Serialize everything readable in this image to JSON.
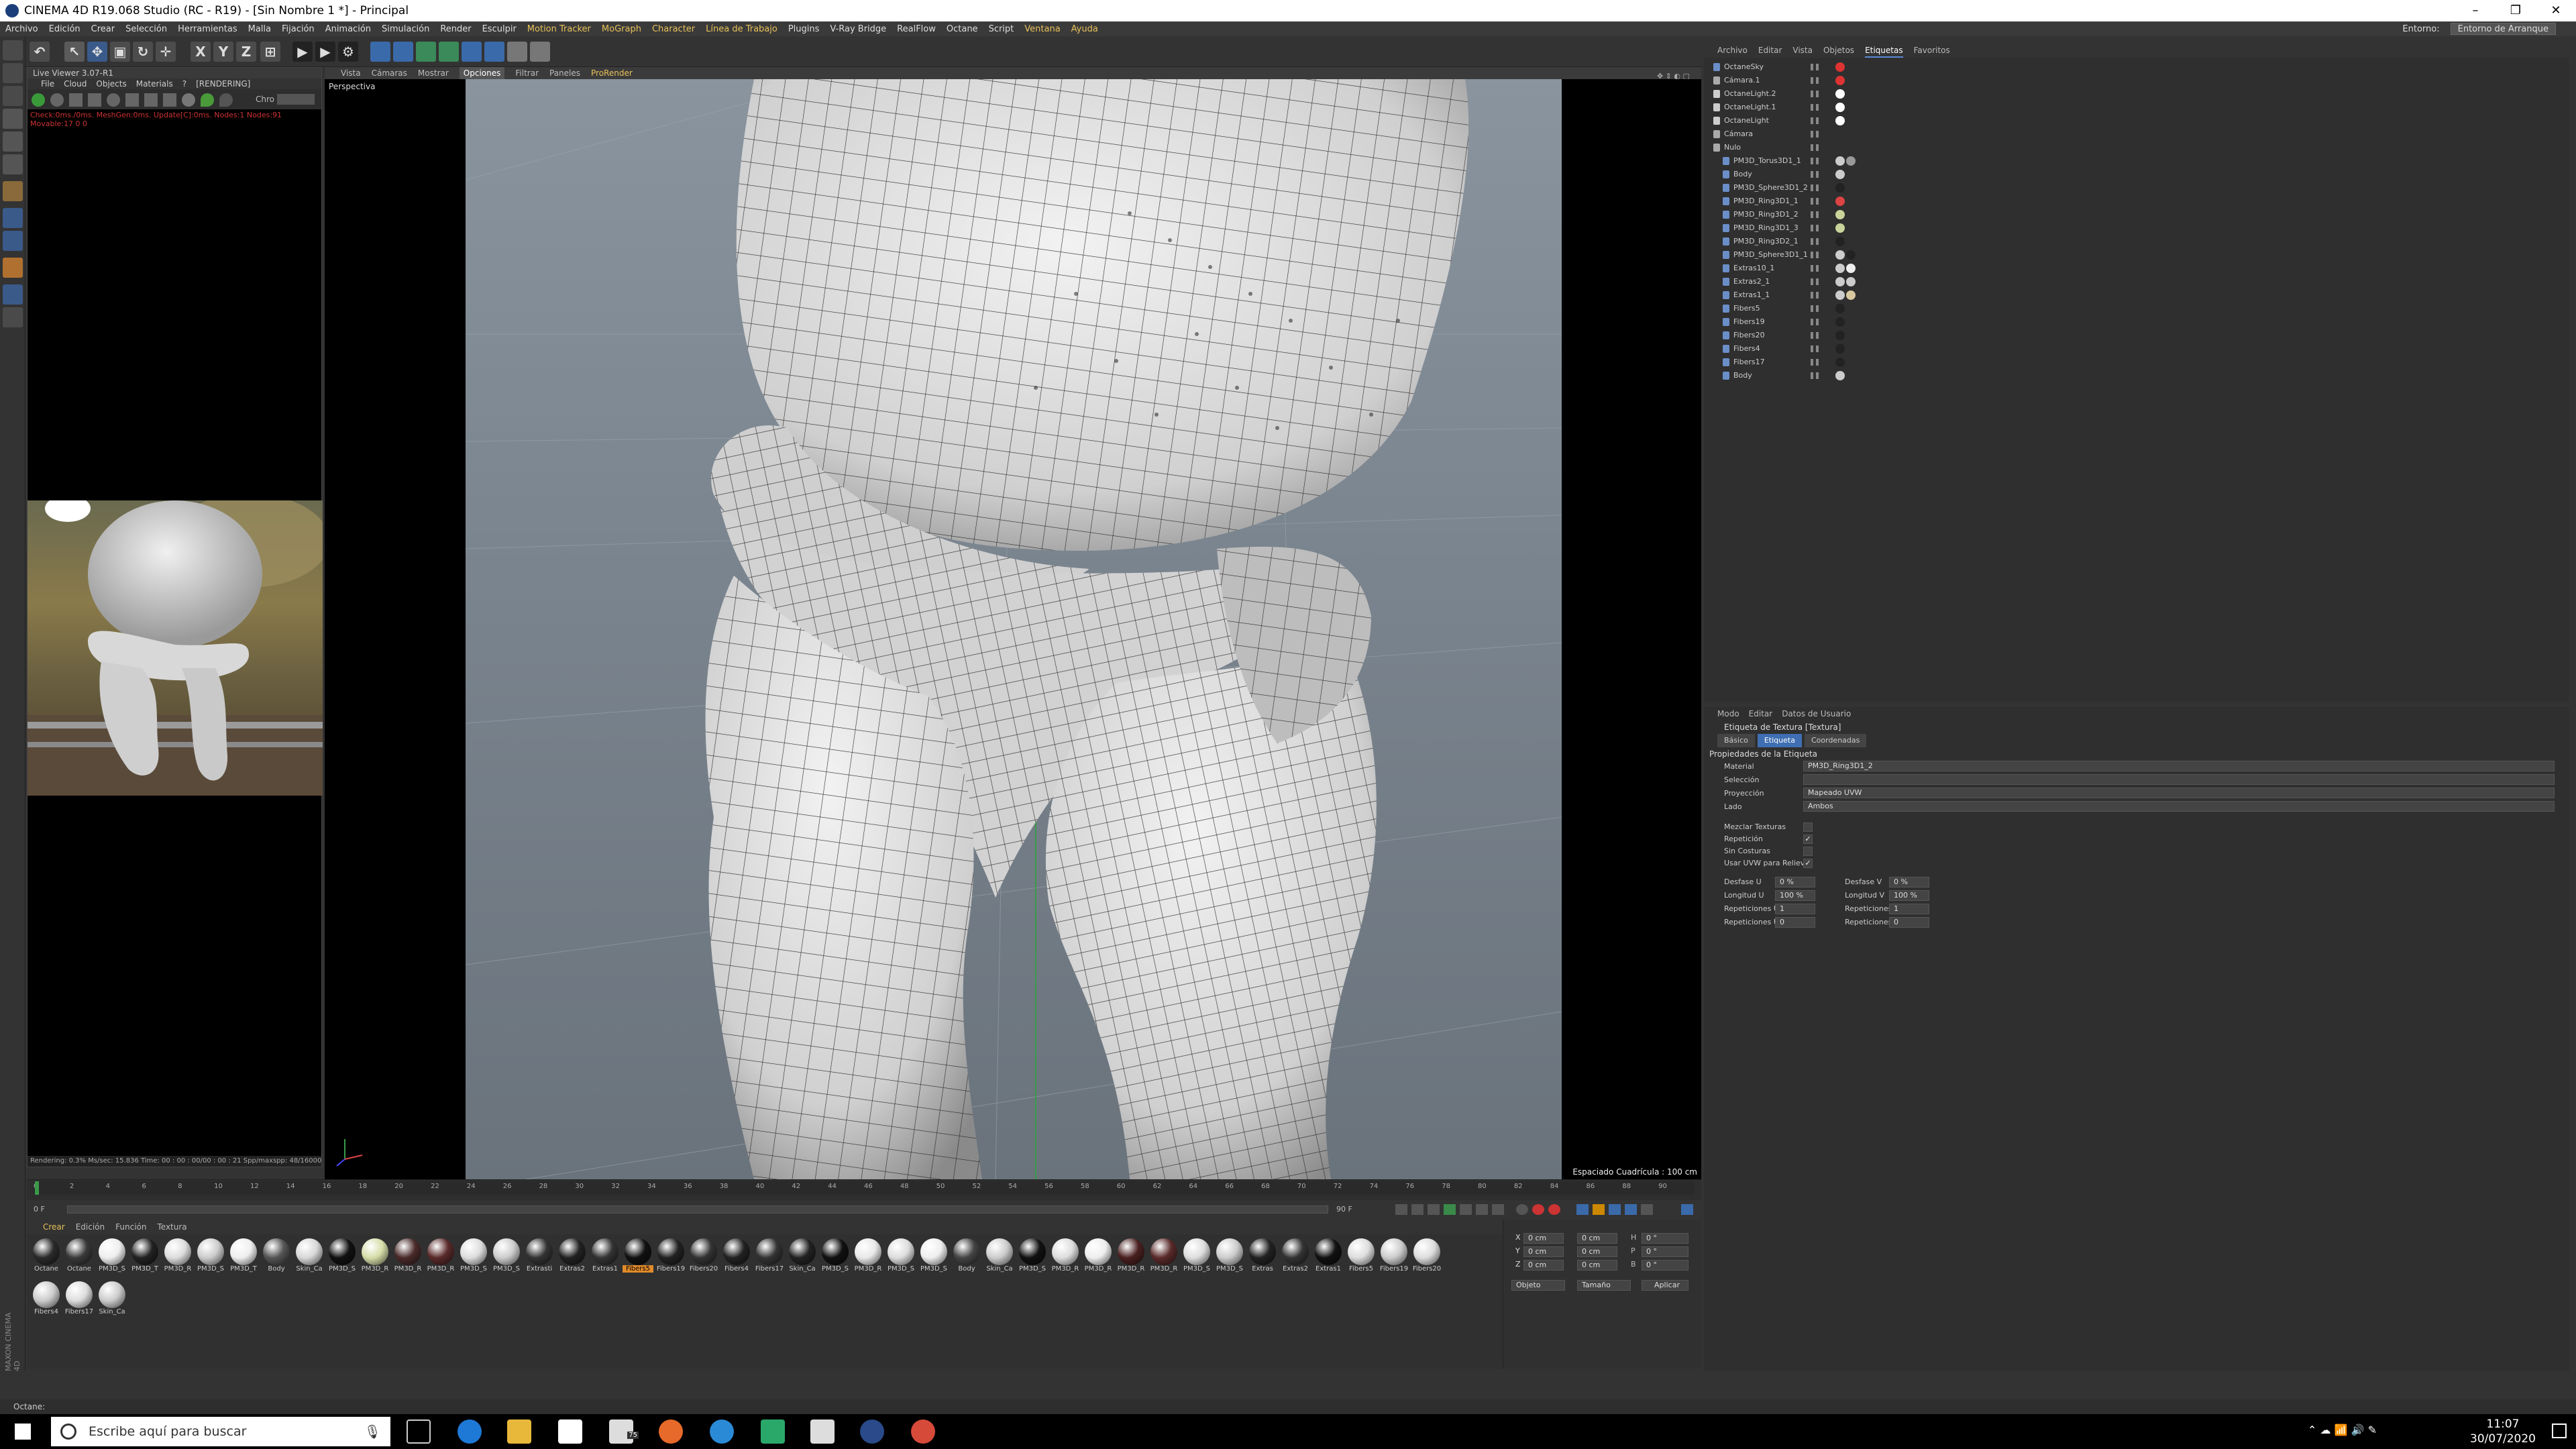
{
  "window": {
    "title": "CINEMA 4D R19.068 Studio (RC - R19) - [Sin Nombre 1 *] - Principal",
    "controls": [
      "–",
      "❐",
      "✕"
    ]
  },
  "menubar": {
    "items": [
      "Archivo",
      "Edición",
      "Crear",
      "Selección",
      "Herramientas",
      "Malla",
      "Fijación",
      "Animación",
      "Simulación",
      "Render",
      "Esculpir",
      "Motion Tracker",
      "MoGraph",
      "Character",
      "Línea de Trabajo",
      "Plugins",
      "V-Ray Bridge",
      "RealFlow",
      "Octane",
      "Script",
      "Ventana",
      "Ayuda"
    ],
    "highlight": [
      "Motion Tracker",
      "MoGraph",
      "Character",
      "Línea de Trabajo",
      "Ventana",
      "Ayuda"
    ],
    "layout_label": "Entorno:",
    "layout_value": "Entorno de Arranque"
  },
  "toolbar": {
    "axis_buttons": [
      "X",
      "Y",
      "Z"
    ]
  },
  "live_viewer": {
    "title": "Live Viewer 3.07-R1",
    "menu": [
      "File",
      "Cloud",
      "Objects",
      "Materials",
      "?",
      "[RENDERING]"
    ],
    "channel_label": "Chro",
    "status": "Check:0ms./0ms. MeshGen:0ms. Update[C]:0ms. Nodes:1 Nodes:91 Movable:17  0  0",
    "footer": "Rendering: 0.3%   Ms/sec: 15.836   Time: 00 : 00 : 00/00 : 00 : 21   Spp/maxspp: 48/16000   Tri: 0/33"
  },
  "viewport": {
    "menu": [
      "Vista",
      "Cámaras",
      "Mostrar",
      "Opciones",
      "Filtrar",
      "Paneles",
      "ProRender"
    ],
    "active_menu": "Opciones",
    "label": "Perspectiva",
    "status": "Espaciado Cuadrícula : 100 cm"
  },
  "timeline": {
    "ticks": [
      "0",
      "2",
      "4",
      "6",
      "8",
      "10",
      "12",
      "14",
      "16",
      "18",
      "20",
      "22",
      "24",
      "26",
      "28",
      "30",
      "32",
      "34",
      "36",
      "38",
      "40",
      "42",
      "44",
      "46",
      "48",
      "50",
      "52",
      "54",
      "56",
      "58",
      "60",
      "62",
      "64",
      "66",
      "68",
      "70",
      "72",
      "74",
      "76",
      "78",
      "80",
      "82",
      "84",
      "86",
      "88",
      "90"
    ],
    "start_field": "0 F",
    "end_field": "90 F",
    "current_frame": "0 F"
  },
  "material_manager": {
    "menu": [
      "Crear",
      "Edición",
      "Función",
      "Textura"
    ],
    "materials": [
      {
        "name": "Octane",
        "color": "#2a2a2a"
      },
      {
        "name": "Octane",
        "color": "#3a3a3a"
      },
      {
        "name": "PM3D_S",
        "color": "#eeeeee"
      },
      {
        "name": "PM3D_T",
        "color": "#222222"
      },
      {
        "name": "PM3D_R",
        "color": "#dddddd"
      },
      {
        "name": "PM3D_S",
        "color": "#cccccc"
      },
      {
        "name": "PM3D_T",
        "color": "#eeeeee"
      },
      {
        "name": "Body",
        "color": "#555555"
      },
      {
        "name": "Skin_Ca",
        "color": "#d8d8d8"
      },
      {
        "name": "PM3D_S",
        "color": "#111111"
      },
      {
        "name": "PM3D_R",
        "color": "#d6dda8"
      },
      {
        "name": "PM3D_R",
        "color": "#4a2a2a"
      },
      {
        "name": "PM3D_R",
        "color": "#5a2a2a"
      },
      {
        "name": "PM3D_S",
        "color": "#dddddd"
      },
      {
        "name": "PM3D_S",
        "color": "#cccccc"
      },
      {
        "name": "Extrasti",
        "color": "#333333"
      },
      {
        "name": "Extras2",
        "color": "#222222"
      },
      {
        "name": "Extras1",
        "color": "#333333"
      },
      {
        "name": "Fibers5",
        "color": "#111111"
      },
      {
        "name": "Fibers19",
        "color": "#222222"
      },
      {
        "name": "Fibers20",
        "color": "#333333"
      },
      {
        "name": "Fibers4",
        "color": "#222222"
      },
      {
        "name": "Fibers17",
        "color": "#333333"
      },
      {
        "name": "Skin_Ca",
        "color": "#222222"
      },
      {
        "name": "PM3D_S",
        "color": "#111111"
      },
      {
        "name": "PM3D_R",
        "color": "#e8e8e8"
      },
      {
        "name": "PM3D_S",
        "color": "#dddddd"
      },
      {
        "name": "PM3D_S",
        "color": "#eeeeee"
      },
      {
        "name": "Body",
        "color": "#444444"
      },
      {
        "name": "Skin_Ca",
        "color": "#cccccc"
      },
      {
        "name": "PM3D_S",
        "color": "#111111"
      },
      {
        "name": "PM3D_R",
        "color": "#dddddd"
      },
      {
        "name": "PM3D_R",
        "color": "#eeeeee"
      },
      {
        "name": "PM3D_R",
        "color": "#4a2020"
      },
      {
        "name": "PM3D_R",
        "color": "#5a2a2a"
      },
      {
        "name": "PM3D_S",
        "color": "#dddddd"
      },
      {
        "name": "PM3D_S",
        "color": "#cccccc"
      },
      {
        "name": "Extras",
        "color": "#222222"
      },
      {
        "name": "Extras2",
        "color": "#333333"
      },
      {
        "name": "Extras1",
        "color": "#111111"
      },
      {
        "name": "Fibers5",
        "color": "#dddddd"
      },
      {
        "name": "Fibers19",
        "color": "#cccccc"
      },
      {
        "name": "Fibers20",
        "color": "#dddddd"
      },
      {
        "name": "Fibers4",
        "color": "#cccccc"
      },
      {
        "name": "Fibers17",
        "color": "#dddddd"
      },
      {
        "name": "Skin_Ca",
        "color": "#cccccc"
      }
    ],
    "selected_index": 18
  },
  "coords": {
    "labels": [
      "X",
      "Y",
      "Z"
    ],
    "pos": [
      "0 cm",
      "0 cm",
      "0 cm"
    ],
    "size": [
      "0 cm",
      "0 cm",
      "0 cm"
    ],
    "rot": [
      "H",
      "P",
      "B"
    ],
    "rot_vals": [
      "0 °",
      "0 °",
      "0 °"
    ],
    "mode1": "Objeto",
    "mode2": "Tamaño",
    "apply": "Aplicar"
  },
  "object_manager": {
    "menu": [
      "Archivo",
      "Editar",
      "Vista",
      "Objetos",
      "Etiquetas",
      "Favoritos"
    ],
    "active_menu": "Etiquetas",
    "objects": [
      {
        "name": "OctaneSky",
        "indent": 0,
        "color": "#6a8ec8",
        "tags": [
          "#d33"
        ]
      },
      {
        "name": "Cámara.1",
        "indent": 0,
        "color": "#aaaaaa",
        "tags": [
          "#d33"
        ]
      },
      {
        "name": "OctaneLight.2",
        "indent": 0,
        "color": "#cccccc",
        "tags": [
          "#fff"
        ]
      },
      {
        "name": "OctaneLight.1",
        "indent": 0,
        "color": "#cccccc",
        "tags": [
          "#fff"
        ]
      },
      {
        "name": "OctaneLight",
        "indent": 0,
        "color": "#cccccc",
        "tags": [
          "#fff"
        ]
      },
      {
        "name": "Cámara",
        "indent": 0,
        "color": "#aaaaaa",
        "tags": []
      },
      {
        "name": "Nulo",
        "indent": 0,
        "color": "#aaaaaa",
        "tags": []
      },
      {
        "name": "PM3D_Torus3D1_1",
        "indent": 1,
        "color": "#6a8ec8",
        "tags": [
          "#ccc",
          "#999"
        ]
      },
      {
        "name": "Body",
        "indent": 1,
        "color": "#6a8ec8",
        "tags": [
          "#ccc"
        ]
      },
      {
        "name": "PM3D_Sphere3D1_2",
        "indent": 1,
        "color": "#6a8ec8",
        "tags": [
          "#222"
        ]
      },
      {
        "name": "PM3D_Ring3D1_1",
        "indent": 1,
        "color": "#6a8ec8",
        "tags": [
          "#d44"
        ]
      },
      {
        "name": "PM3D_Ring3D1_2",
        "indent": 1,
        "color": "#6a8ec8",
        "tags": [
          "#c9d49a"
        ]
      },
      {
        "name": "PM3D_Ring3D1_3",
        "indent": 1,
        "color": "#6a8ec8",
        "tags": [
          "#c9d49a"
        ]
      },
      {
        "name": "PM3D_Ring3D2_1",
        "indent": 1,
        "color": "#6a8ec8",
        "tags": [
          "#222"
        ]
      },
      {
        "name": "PM3D_Sphere3D1_1",
        "indent": 1,
        "color": "#6a8ec8",
        "tags": [
          "#ccc",
          "#222"
        ]
      },
      {
        "name": "Extras10_1",
        "indent": 1,
        "color": "#6a8ec8",
        "tags": [
          "#ccc",
          "#eee"
        ]
      },
      {
        "name": "Extras2_1",
        "indent": 1,
        "color": "#6a8ec8",
        "tags": [
          "#ccc",
          "#ccc"
        ]
      },
      {
        "name": "Extras1_1",
        "indent": 1,
        "color": "#6a8ec8",
        "tags": [
          "#ccc",
          "#d9c9a0"
        ]
      },
      {
        "name": "Fibers5",
        "indent": 1,
        "color": "#6a8ec8",
        "tags": [
          "#222"
        ]
      },
      {
        "name": "Fibers19",
        "indent": 1,
        "color": "#6a8ec8",
        "tags": [
          "#222"
        ]
      },
      {
        "name": "Fibers20",
        "indent": 1,
        "color": "#6a8ec8",
        "tags": [
          "#222"
        ]
      },
      {
        "name": "Fibers4",
        "indent": 1,
        "color": "#6a8ec8",
        "tags": [
          "#222"
        ]
      },
      {
        "name": "Fibers17",
        "indent": 1,
        "color": "#6a8ec8",
        "tags": [
          "#222"
        ]
      },
      {
        "name": "Body",
        "indent": 1,
        "color": "#6a8ec8",
        "tags": [
          "#ccc"
        ]
      }
    ]
  },
  "attributes": {
    "menu": [
      "Modo",
      "Editar",
      "Datos de Usuario"
    ],
    "title": "Etiqueta de Textura [Textura]",
    "tabs": [
      "Básico",
      "Etiqueta",
      "Coordenadas"
    ],
    "active_tab": "Etiqueta",
    "section": "Propiedades de la Etiqueta",
    "material_label": "Material",
    "material_value": "PM3D_Ring3D1_2",
    "selection_label": "Selección",
    "projection_label": "Proyección",
    "projection_value": "Mapeado UVW",
    "side_label": "Lado",
    "side_value": "Ambos",
    "checks": [
      {
        "label": "Mezclar Texturas",
        "checked": false
      },
      {
        "label": "Repetición",
        "checked": true
      },
      {
        "label": "Sin Costuras",
        "checked": false
      },
      {
        "label": "Usar UVW para Relieve",
        "checked": true
      }
    ],
    "grid": [
      {
        "l1": "Desfase U",
        "v1": "0 %",
        "l2": "Desfase V",
        "v2": "0 %"
      },
      {
        "l1": "Longitud U",
        "v1": "100 %",
        "l2": "Longitud V",
        "v2": "100 %"
      },
      {
        "l1": "Repeticiones U",
        "v1": "1",
        "l2": "Repeticiones V",
        "v2": "1"
      },
      {
        "l1": "Repeticiones U",
        "v1": "0",
        "l2": "Repeticiones V",
        "v2": "0"
      }
    ]
  },
  "statusbar": {
    "text": "Octane:"
  },
  "taskbar": {
    "search_placeholder": "Escribe aquí para buscar",
    "mail_badge": "75",
    "time": "11:07",
    "date": "30/07/2020"
  }
}
